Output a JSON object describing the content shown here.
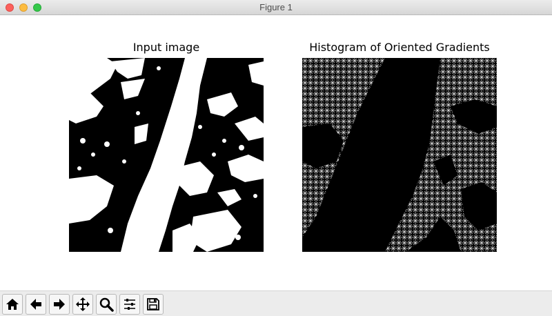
{
  "window": {
    "title": "Figure 1"
  },
  "figure": {
    "axes": [
      {
        "title": "Input image"
      },
      {
        "title": "Histogram of Oriented Gradients"
      }
    ]
  },
  "toolbar": {
    "buttons": [
      {
        "name": "home",
        "icon": "home-icon"
      },
      {
        "name": "back",
        "icon": "arrow-left-icon"
      },
      {
        "name": "forward",
        "icon": "arrow-right-icon"
      },
      {
        "name": "pan",
        "icon": "move-icon"
      },
      {
        "name": "zoom",
        "icon": "magnifier-icon"
      },
      {
        "name": "configure",
        "icon": "sliders-icon"
      },
      {
        "name": "save",
        "icon": "floppy-disk-icon"
      }
    ]
  }
}
